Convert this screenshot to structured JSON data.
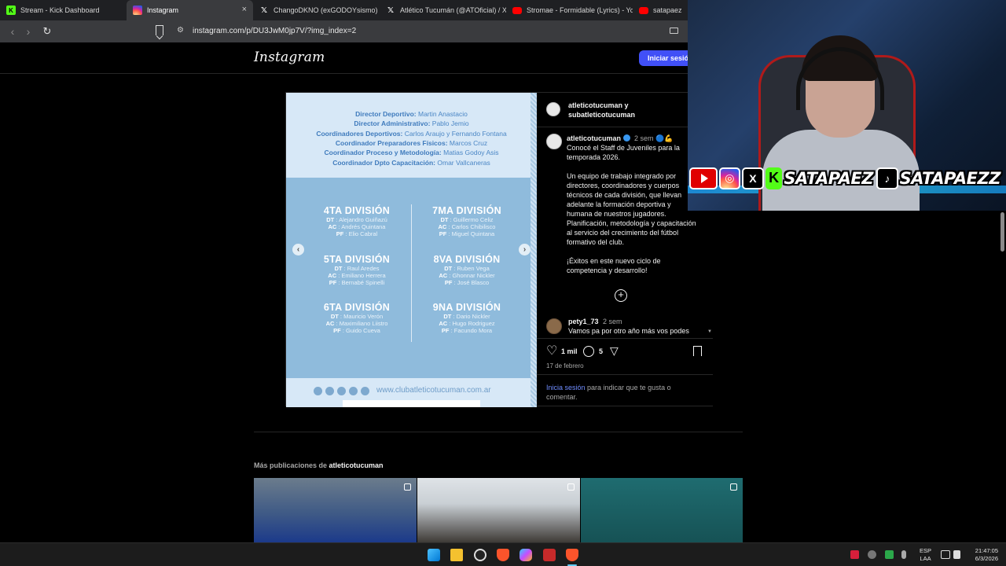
{
  "browser": {
    "tabs": [
      {
        "title": "Stream - Kick Dashboard",
        "icon": "kick-icon",
        "active": false
      },
      {
        "title": "Instagram",
        "icon": "instagram-icon",
        "active": true
      },
      {
        "title": "ChangoDKNO (exGODOYsismo) en X",
        "icon": "x-icon",
        "active": false
      },
      {
        "title": "Atlético Tucumán (@ATOficial) / X",
        "icon": "x-icon",
        "active": false
      },
      {
        "title": "Stromae - Formidable (Lyrics) - YouT",
        "icon": "youtube-icon",
        "active": false
      },
      {
        "title": "satapaez",
        "icon": "youtube-icon",
        "active": false
      }
    ],
    "tab_close_glyph": "×",
    "url": "instagram.com/p/DU3JwM0jp7V/?img_index=2"
  },
  "instagram": {
    "logo": "Instagram",
    "login_button": "Iniciar sesió",
    "post": {
      "image": {
        "staff": [
          {
            "role": "Director Deportivo:",
            "name": "Martin Anastacio"
          },
          {
            "role": "Director Administrativo:",
            "name": "Pablo Jemio"
          },
          {
            "role": "Coordinadores Deportivos:",
            "name": "Carlos Araujo y Fernando Fontana"
          },
          {
            "role": "Coordinador Preparadores Físicos:",
            "name": "Marcos Cruz"
          },
          {
            "role": "Coordinador Proceso y Metodología:",
            "name": "Matias Godoy Asis"
          },
          {
            "role": "Coordinador Dpto Capacitación:",
            "name": "Omar Vallcaneras"
          }
        ],
        "divisions": [
          {
            "title": "4TA DIVISIÓN",
            "dt": "Alejandro Guiñazú",
            "ac": "Andrés Quintana",
            "pf": "Elio Cabral"
          },
          {
            "title": "7MA DIVISIÓN",
            "dt": "Guillermo Celiz",
            "ac": "Carlos Chibilisco",
            "pf": "Miguel Quintana"
          },
          {
            "title": "5TA DIVISIÓN",
            "dt": "Raul Aredes",
            "ac": "Emiliano Herrera",
            "pf": "Bernabé Spinelli"
          },
          {
            "title": "8VA DIVISIÓN",
            "dt": "Ruben Vega",
            "ac": "Ghonnar Nickler",
            "pf": "José Blasco"
          },
          {
            "title": "6TA DIVISIÓN",
            "dt": "Mauricio Verón",
            "ac": "Maximiliano Liistro",
            "pf": "Guido Cueva"
          },
          {
            "title": "9NA DIVISIÓN",
            "dt": "Dario Nickler",
            "ac": "Hugo Rodriguez",
            "pf": "Facundo Mora"
          }
        ],
        "role_labels": {
          "dt": "DT",
          "ac": "AC",
          "pf": "PF"
        },
        "website": "www.clubatleticotucuman.com.ar",
        "prev_glyph": "‹",
        "next_glyph": "›"
      },
      "header_line1": "atleticotucuman y",
      "header_line2": "subatleticotucuman",
      "caption": {
        "username": "atleticotucuman",
        "time": "2 sem",
        "line1": "🔵💪 Conocé el Staff de Juveniles para la temporada 2026.",
        "para2": "Un equipo de trabajo integrado por directores, coordinadores y cuerpos técnicos de cada división, que llevan adelante la formación deportiva y humana de nuestros jugadores. Planificación, metodología y capacitación al servicio del crecimiento del fútbol formativo del club.",
        "para3": "¡Éxitos en este nuevo ciclo de competencia y desarrollo!"
      },
      "more_glyph": "+",
      "comment": {
        "username": "pety1_73",
        "time": "2 sem",
        "text": "Vamos pa por otro año más vos podes"
      },
      "likes": "1 mil",
      "comments": "5",
      "like_glyph": "♡",
      "share_glyph": "▽",
      "date": "17 de febrero",
      "login_prompt_link": "Inicia sesión",
      "login_prompt_rest": " para indicar que te gusta o comentar."
    },
    "more_posts": {
      "prefix": "Más publicaciones de ",
      "account": "atleticotucuman"
    }
  },
  "overlay": {
    "kick_letter": "K",
    "x_letter": "X",
    "tiktok_glyph": "♪",
    "handle_kick": "SATAPAEZ",
    "handle_tiktok": "SATAPAEZZ"
  },
  "taskbar": {
    "lang1": "ESP",
    "lang2": "LAA",
    "time": "21:47:05",
    "date": "6/3/2026"
  }
}
